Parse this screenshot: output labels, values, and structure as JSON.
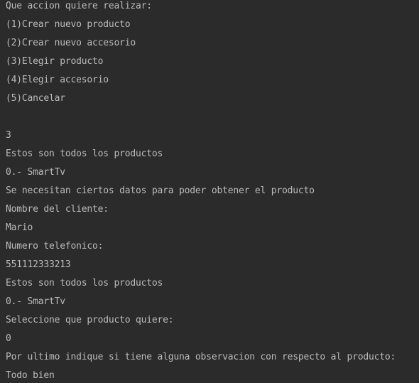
{
  "console": {
    "lines": [
      {
        "text": "Que accion quiere realizar:",
        "kind": "output"
      },
      {
        "text": "(1)Crear nuevo producto",
        "kind": "output"
      },
      {
        "text": "(2)Crear nuevo accesorio",
        "kind": "output"
      },
      {
        "text": "(3)Elegir producto",
        "kind": "output"
      },
      {
        "text": "(4)Elegir accesorio",
        "kind": "output"
      },
      {
        "text": "(5)Cancelar",
        "kind": "output"
      },
      {
        "text": "",
        "kind": "output"
      },
      {
        "text": "3",
        "kind": "input"
      },
      {
        "text": "Estos son todos los productos",
        "kind": "output"
      },
      {
        "text": "0.- SmartTv",
        "kind": "output"
      },
      {
        "text": "Se necesitan ciertos datos para poder obtener el producto",
        "kind": "output"
      },
      {
        "text": "Nombre del cliente:",
        "kind": "output"
      },
      {
        "text": "Mario",
        "kind": "input"
      },
      {
        "text": "Numero telefonico:",
        "kind": "output"
      },
      {
        "text": "551112333213",
        "kind": "input"
      },
      {
        "text": "Estos son todos los productos",
        "kind": "output"
      },
      {
        "text": "0.- SmartTv",
        "kind": "output"
      },
      {
        "text": "Seleccione que producto quiere:",
        "kind": "output"
      },
      {
        "text": "0",
        "kind": "input"
      },
      {
        "text": "Por ultimo indique si tiene alguna observacion con respecto al producto:",
        "kind": "output"
      },
      {
        "text": "Todo bien",
        "kind": "input"
      }
    ]
  },
  "colors": {
    "background": "#2b2b2b",
    "text": "#bbbbbb"
  }
}
